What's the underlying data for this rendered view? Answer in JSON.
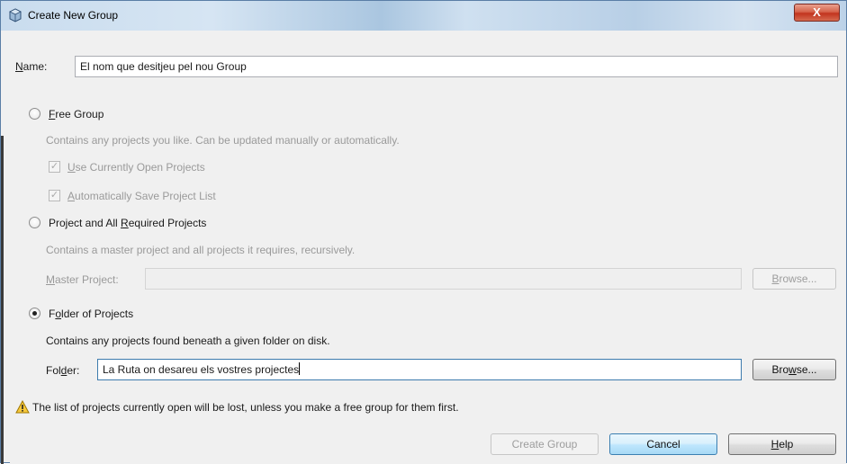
{
  "window": {
    "title": "Create New Group",
    "close_symbol": "X"
  },
  "name_field": {
    "label_mnemonic": "N",
    "label_rest": "ame:",
    "value": "El nom que desitjeu pel nou Group"
  },
  "free_group": {
    "radio_mnemonic": "F",
    "radio_rest": "ree Group",
    "selected": false,
    "description": "Contains any projects you like. Can be updated manually or automatically.",
    "use_open": {
      "mnemonic": "U",
      "rest": "se Currently Open Projects",
      "checked": true
    },
    "auto_save": {
      "mnemonic": "A",
      "rest": "utomatically Save Project List",
      "checked": true
    }
  },
  "required_projects": {
    "radio_pre": "Project and All ",
    "radio_mnemonic": "R",
    "radio_rest": "equired Projects",
    "selected": false,
    "description": "Contains a master project and all projects it requires, recursively.",
    "master_label_mnemonic": "M",
    "master_label_rest": "aster Project:",
    "master_value": "",
    "browse_mnemonic": "B",
    "browse_rest": "rowse..."
  },
  "folder_projects": {
    "radio_pre": "F",
    "radio_mnemonic": "o",
    "radio_rest": "lder of Projects",
    "selected": true,
    "description": "Contains any projects found beneath a given folder on disk.",
    "folder_label_pre": "Fol",
    "folder_label_mnemonic": "d",
    "folder_label_rest": "er:",
    "folder_value": "La Ruta on desareu els vostres projectes",
    "browse_pre": "Bro",
    "browse_mnemonic": "w",
    "browse_rest": "se..."
  },
  "warning": {
    "text": "The list of projects currently open will be lost, unless you make a free group for them first."
  },
  "buttons": {
    "create": "Create Group",
    "cancel": "Cancel",
    "help_mnemonic": "H",
    "help_rest": "elp"
  }
}
